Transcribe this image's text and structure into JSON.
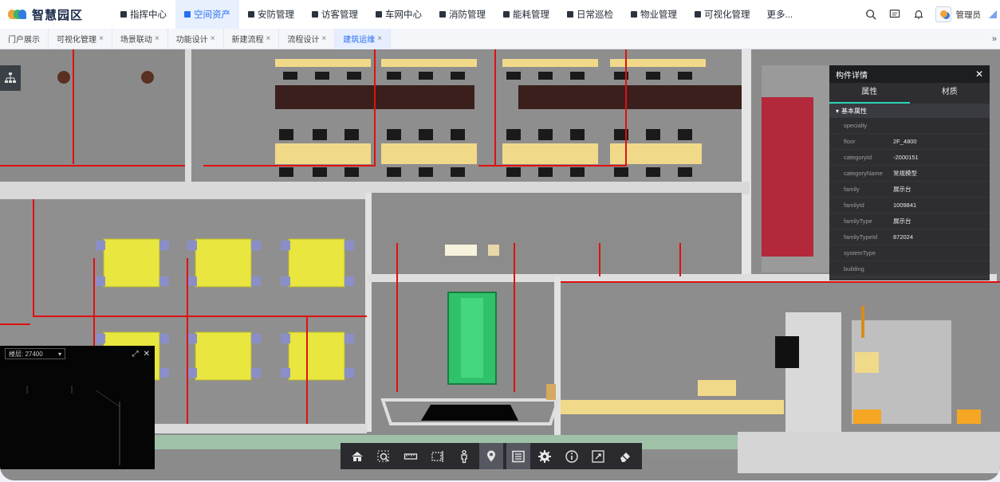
{
  "app": {
    "logo_text": "智慧园区"
  },
  "nav": {
    "items": [
      {
        "label": "指挥中心",
        "icon": "monitor-icon"
      },
      {
        "label": "空间资产",
        "icon": "table-icon",
        "active": true
      },
      {
        "label": "安防管理",
        "icon": "document-icon"
      },
      {
        "label": "访客管理",
        "icon": "person-icon"
      },
      {
        "label": "车网中心",
        "icon": "car-icon"
      },
      {
        "label": "消防管理",
        "icon": "fire-extinguisher-icon"
      },
      {
        "label": "能耗管理",
        "icon": "grid-icon"
      },
      {
        "label": "日常巡检",
        "icon": "calendar-icon"
      },
      {
        "label": "物业管理",
        "icon": "person-icon"
      },
      {
        "label": "可视化管理",
        "icon": "screen-icon"
      }
    ],
    "more_label": "更多..."
  },
  "header": {
    "user_name": "管理员"
  },
  "tabs": [
    {
      "label": "门户展示",
      "closable": false
    },
    {
      "label": "可视化管理",
      "closable": true
    },
    {
      "label": "场景联动",
      "closable": true
    },
    {
      "label": "功能设计",
      "closable": true
    },
    {
      "label": "新建流程",
      "closable": true
    },
    {
      "label": "流程设计",
      "closable": true
    },
    {
      "label": "建筑运维",
      "closable": true,
      "active": true
    }
  ],
  "panel": {
    "title": "构件详情",
    "tabs": [
      "属性",
      "材质"
    ],
    "section": "基本属性",
    "properties": [
      {
        "key": "specialty",
        "value": ""
      },
      {
        "key": "floor",
        "value": "2F_4800"
      },
      {
        "key": "categoryId",
        "value": "-2000151"
      },
      {
        "key": "categoryName",
        "value": "常规模型"
      },
      {
        "key": "family",
        "value": "展示台"
      },
      {
        "key": "familyId",
        "value": "1009841"
      },
      {
        "key": "familyType",
        "value": "展示台"
      },
      {
        "key": "familyTypeId",
        "value": "872024"
      },
      {
        "key": "systemType",
        "value": ""
      },
      {
        "key": "building",
        "value": ""
      }
    ]
  },
  "minimap": {
    "floor_label": "楼层: 27400"
  },
  "toolbar": {
    "buttons": [
      {
        "icon": "home-icon"
      },
      {
        "icon": "zoom-region-icon"
      },
      {
        "icon": "measure-ruler-icon"
      },
      {
        "icon": "section-box-icon"
      },
      {
        "icon": "person-walk-icon"
      },
      {
        "icon": "location-pin-icon",
        "active": true
      },
      {
        "icon": "component-list-icon",
        "active": true
      },
      {
        "icon": "settings-gear-icon"
      },
      {
        "icon": "info-icon"
      },
      {
        "icon": "fullscreen-icon"
      },
      {
        "icon": "eraser-icon"
      }
    ]
  },
  "colors": {
    "accent": "#2a6ef2",
    "pipe": "#e01010",
    "panel_tab_accent": "#2bd4b8"
  }
}
